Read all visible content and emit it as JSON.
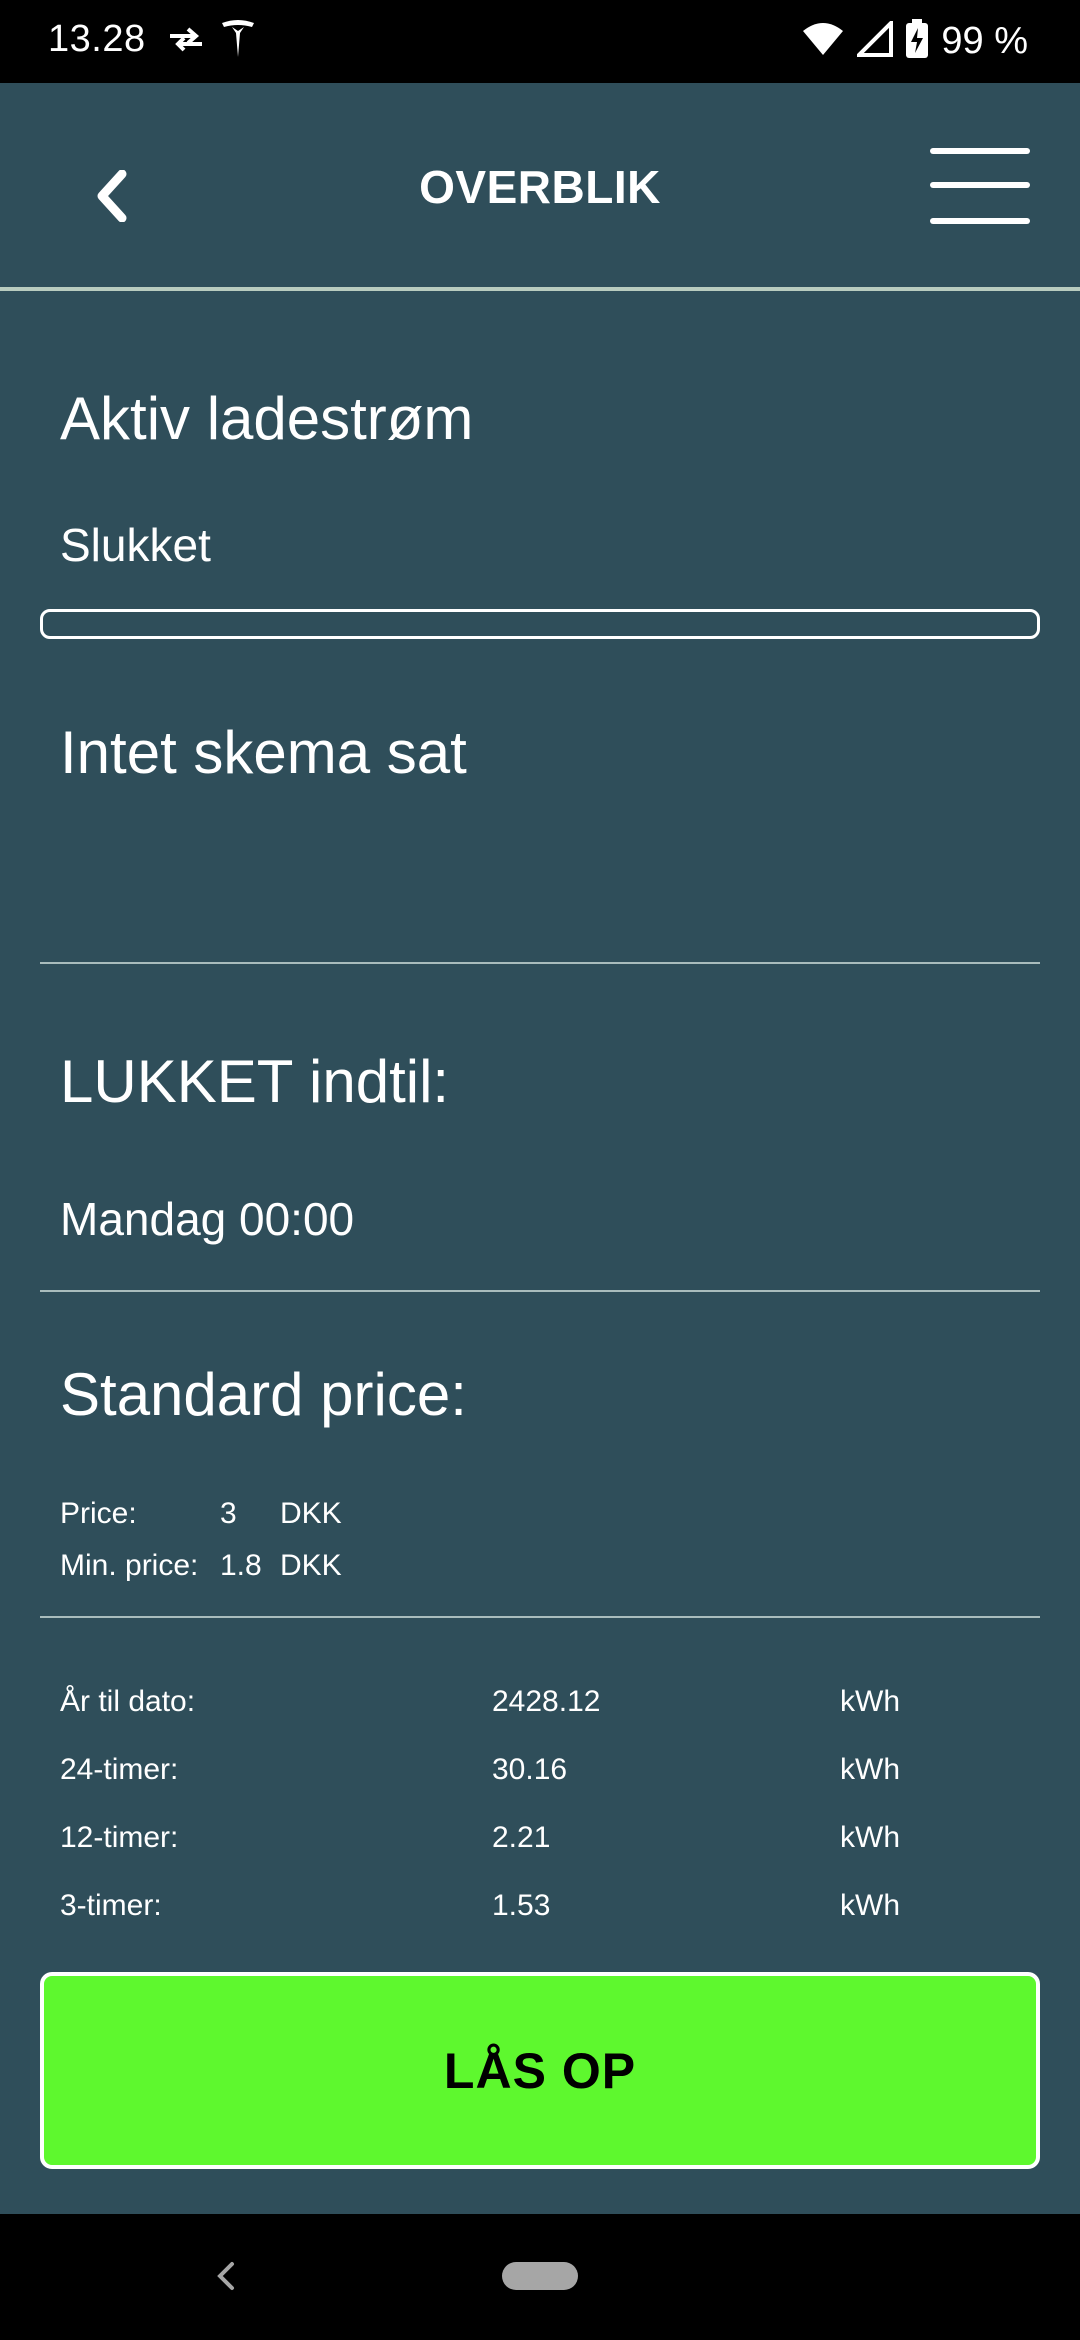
{
  "status_bar": {
    "time": "13.28",
    "battery": "99 %",
    "icons": [
      "data-transfer-icon",
      "tesla-logo-icon",
      "wifi-icon",
      "cell-signal-icon",
      "battery-charging-icon"
    ]
  },
  "header": {
    "title": "OVERBLIK",
    "back_icon": "chevron-left-icon",
    "menu_icon": "hamburger-menu-icon"
  },
  "charging": {
    "heading": "Aktiv ladestrøm",
    "status": "Slukket",
    "progress_fraction": 0
  },
  "schedule": {
    "heading": "Intet skema sat"
  },
  "lock": {
    "heading": "LUKKET indtil:",
    "until": "Mandag 00:00"
  },
  "standard_price": {
    "heading": "Standard price:",
    "rows": [
      {
        "label": "Price:",
        "value": "3",
        "unit": "DKK"
      },
      {
        "label": "Min. price:",
        "value": "1.8",
        "unit": "DKK"
      }
    ]
  },
  "stats": {
    "rows": [
      {
        "label": "År til dato:",
        "value": "2428.12",
        "unit": "kWh"
      },
      {
        "label": "24-timer:",
        "value": "30.16",
        "unit": "kWh"
      },
      {
        "label": "12-timer:",
        "value": "2.21",
        "unit": "kWh"
      },
      {
        "label": "3-timer:",
        "value": "1.53",
        "unit": "kWh"
      }
    ]
  },
  "unlock_button": {
    "label": "LÅS OP"
  },
  "colors": {
    "background": "#2f4e5a",
    "accent_green": "#5ef82e",
    "divider": "#a9bcbc"
  }
}
